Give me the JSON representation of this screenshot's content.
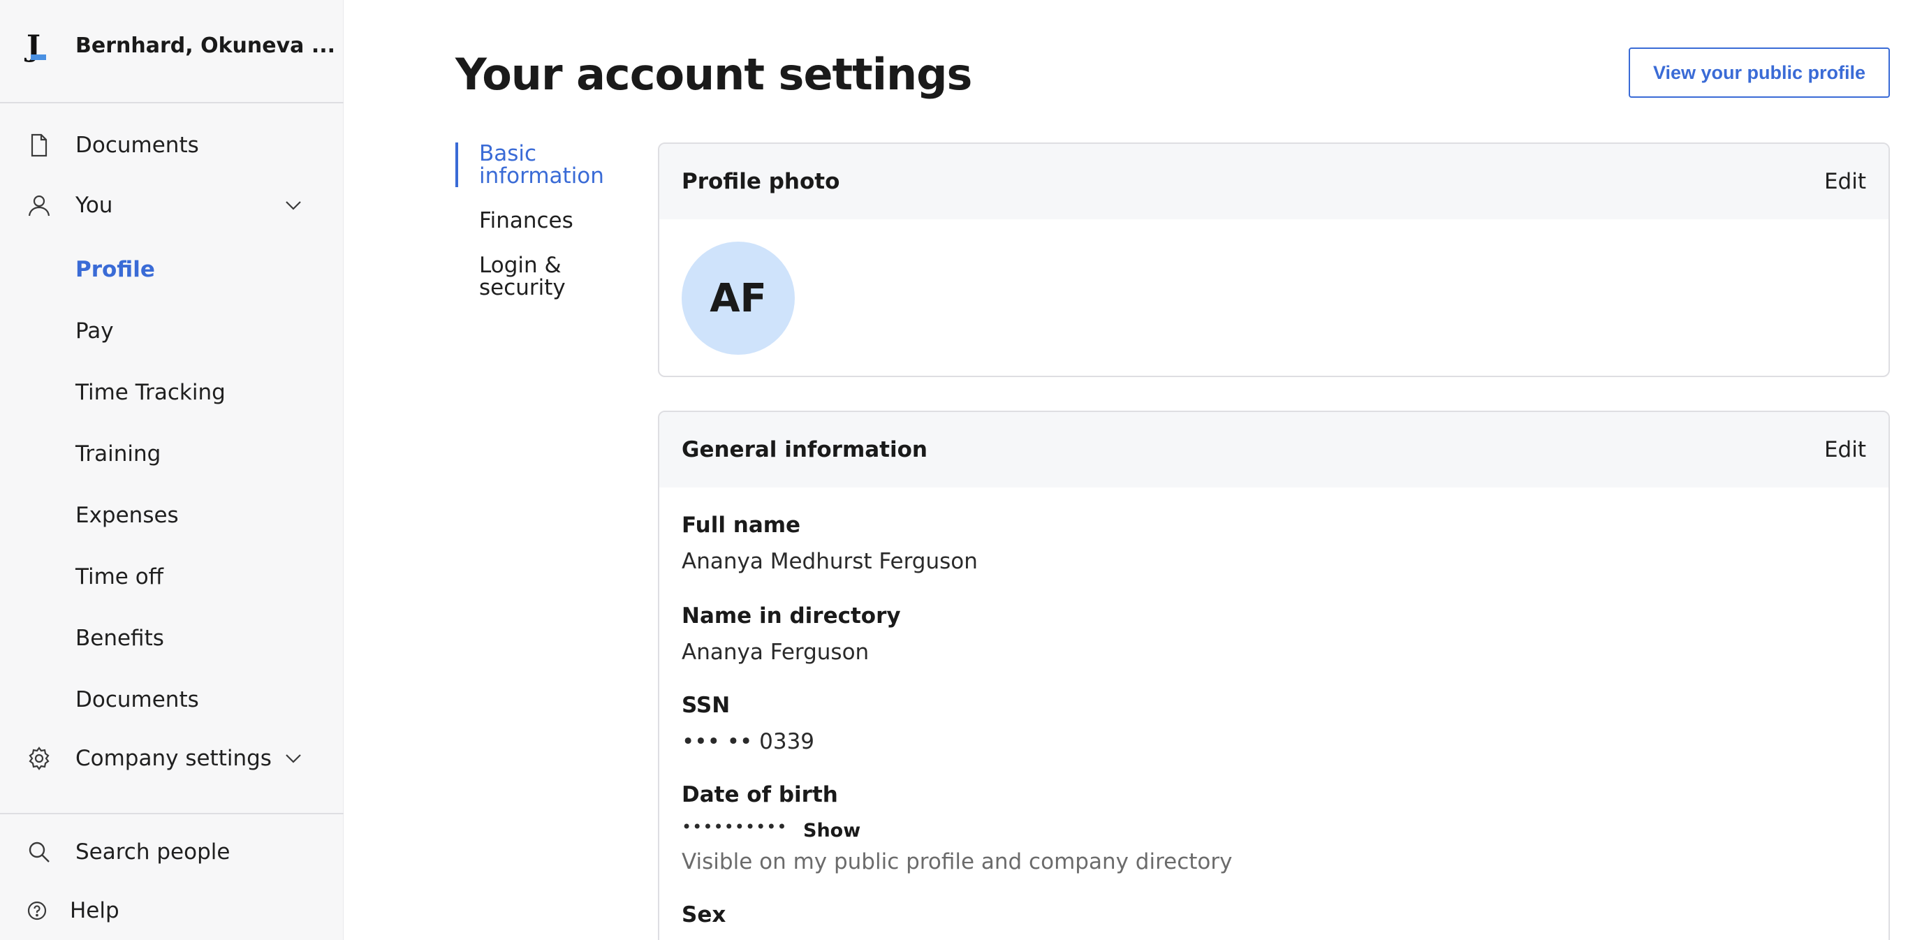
{
  "sidebar": {
    "company_name": "Bernhard, Okuneva ...",
    "logo_letter": "J",
    "nav": {
      "documents": "Documents",
      "you": "You",
      "company_settings": "Company settings",
      "search_people": "Search people",
      "help": "Help"
    },
    "you_items": [
      {
        "label": "Profile",
        "active": true
      },
      {
        "label": "Pay"
      },
      {
        "label": "Time Tracking"
      },
      {
        "label": "Training"
      },
      {
        "label": "Expenses"
      },
      {
        "label": "Time off"
      },
      {
        "label": "Benefits"
      },
      {
        "label": "Documents"
      }
    ],
    "icons": {
      "documents": "document-icon",
      "you": "person-icon",
      "company_settings": "gear-icon",
      "search_people": "search-icon",
      "help": "help-icon",
      "expand": "chevron-down-icon"
    }
  },
  "main": {
    "title": "Your account settings",
    "public_profile_button": "View your public profile",
    "subnav": [
      {
        "label": "Basic\ninformation",
        "active": true
      },
      {
        "label": "Finances"
      },
      {
        "label": "Login &\nsecurity"
      }
    ],
    "profile_photo": {
      "title": "Profile photo",
      "edit": "Edit",
      "initials": "AF"
    },
    "general_information": {
      "title": "General information",
      "edit": "Edit",
      "full_name_label": "Full name",
      "full_name": "Ananya Medhurst Ferguson",
      "directory_name_label": "Name in directory",
      "directory_name": "Ananya Ferguson",
      "ssn_label": "SSN",
      "ssn": "••• •• 0339",
      "dob_label": "Date of birth",
      "dob": "••••••••••",
      "dob_show": "Show",
      "dob_note": "Visible on my public profile and company directory",
      "sex_label": "Sex"
    }
  },
  "colors": {
    "accent": "#3a6bd6",
    "sidebar_bg": "#f7f7f8",
    "avatar_bg": "#cfe3fb",
    "card_header_bg": "#f6f7f9",
    "logo_accent": "#4a90e2"
  }
}
